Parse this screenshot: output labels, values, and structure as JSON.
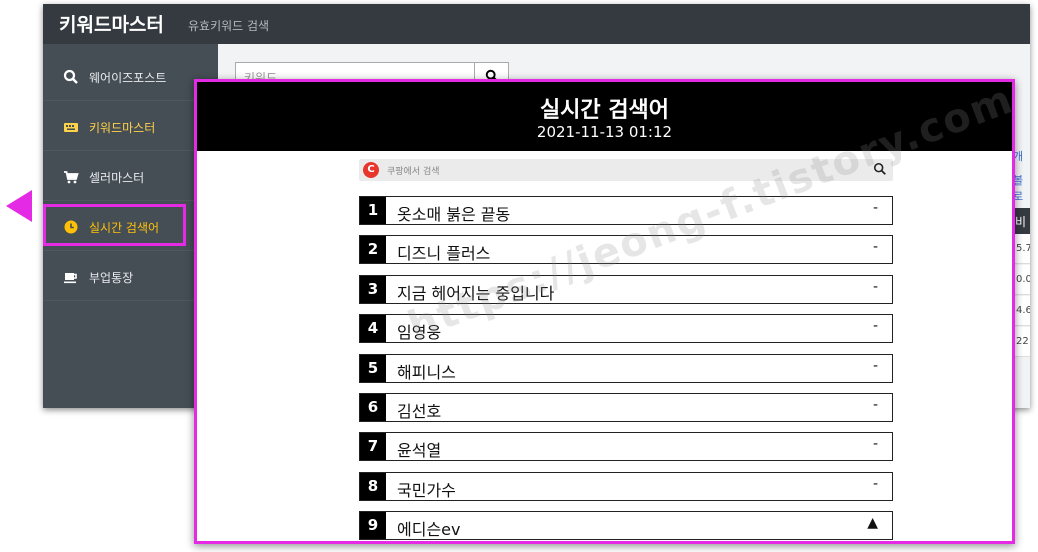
{
  "app": {
    "brand": "키워드마스터",
    "subtitle": "유효키워드 검색",
    "nav": [
      {
        "label": "웨어이즈포스트",
        "icon": "search-icon"
      },
      {
        "label": "키워드마스터",
        "icon": "keyboard-icon"
      },
      {
        "label": "셀러마스터",
        "icon": "cart-icon"
      },
      {
        "label": "실시간 검색어",
        "icon": "clock-icon"
      },
      {
        "label": "부업통장",
        "icon": "coffee-icon"
      }
    ],
    "search_placeholder": "키워드",
    "right_links": [
      "개",
      "볼로"
    ],
    "right_header": "비",
    "right_cells": [
      "5.7",
      "0.0",
      "4.6",
      "22"
    ]
  },
  "popup": {
    "title": "실시간 검색어",
    "datetime": "2021-11-13 01:12",
    "coupang_placeholder": "쿠팡에서 검색",
    "coupang_logo": "C",
    "rankings": [
      {
        "rank": "1",
        "keyword": "옷소매 붉은 끝동",
        "trend": "-"
      },
      {
        "rank": "2",
        "keyword": "디즈니 플러스",
        "trend": "-"
      },
      {
        "rank": "3",
        "keyword": "지금 헤어지는 중입니다",
        "trend": "-"
      },
      {
        "rank": "4",
        "keyword": "임영웅",
        "trend": "-"
      },
      {
        "rank": "5",
        "keyword": "해피니스",
        "trend": "-"
      },
      {
        "rank": "6",
        "keyword": "김선호",
        "trend": "-"
      },
      {
        "rank": "7",
        "keyword": "윤석열",
        "trend": "-"
      },
      {
        "rank": "8",
        "keyword": "국민가수",
        "trend": "-"
      },
      {
        "rank": "9",
        "keyword": "에디슨ev",
        "trend": "▲"
      }
    ]
  },
  "watermark": "https://jeong-f.tistory.com",
  "colors": {
    "highlight": "#e52ae5",
    "header": "#000000",
    "active_nav": "#ffc107"
  }
}
